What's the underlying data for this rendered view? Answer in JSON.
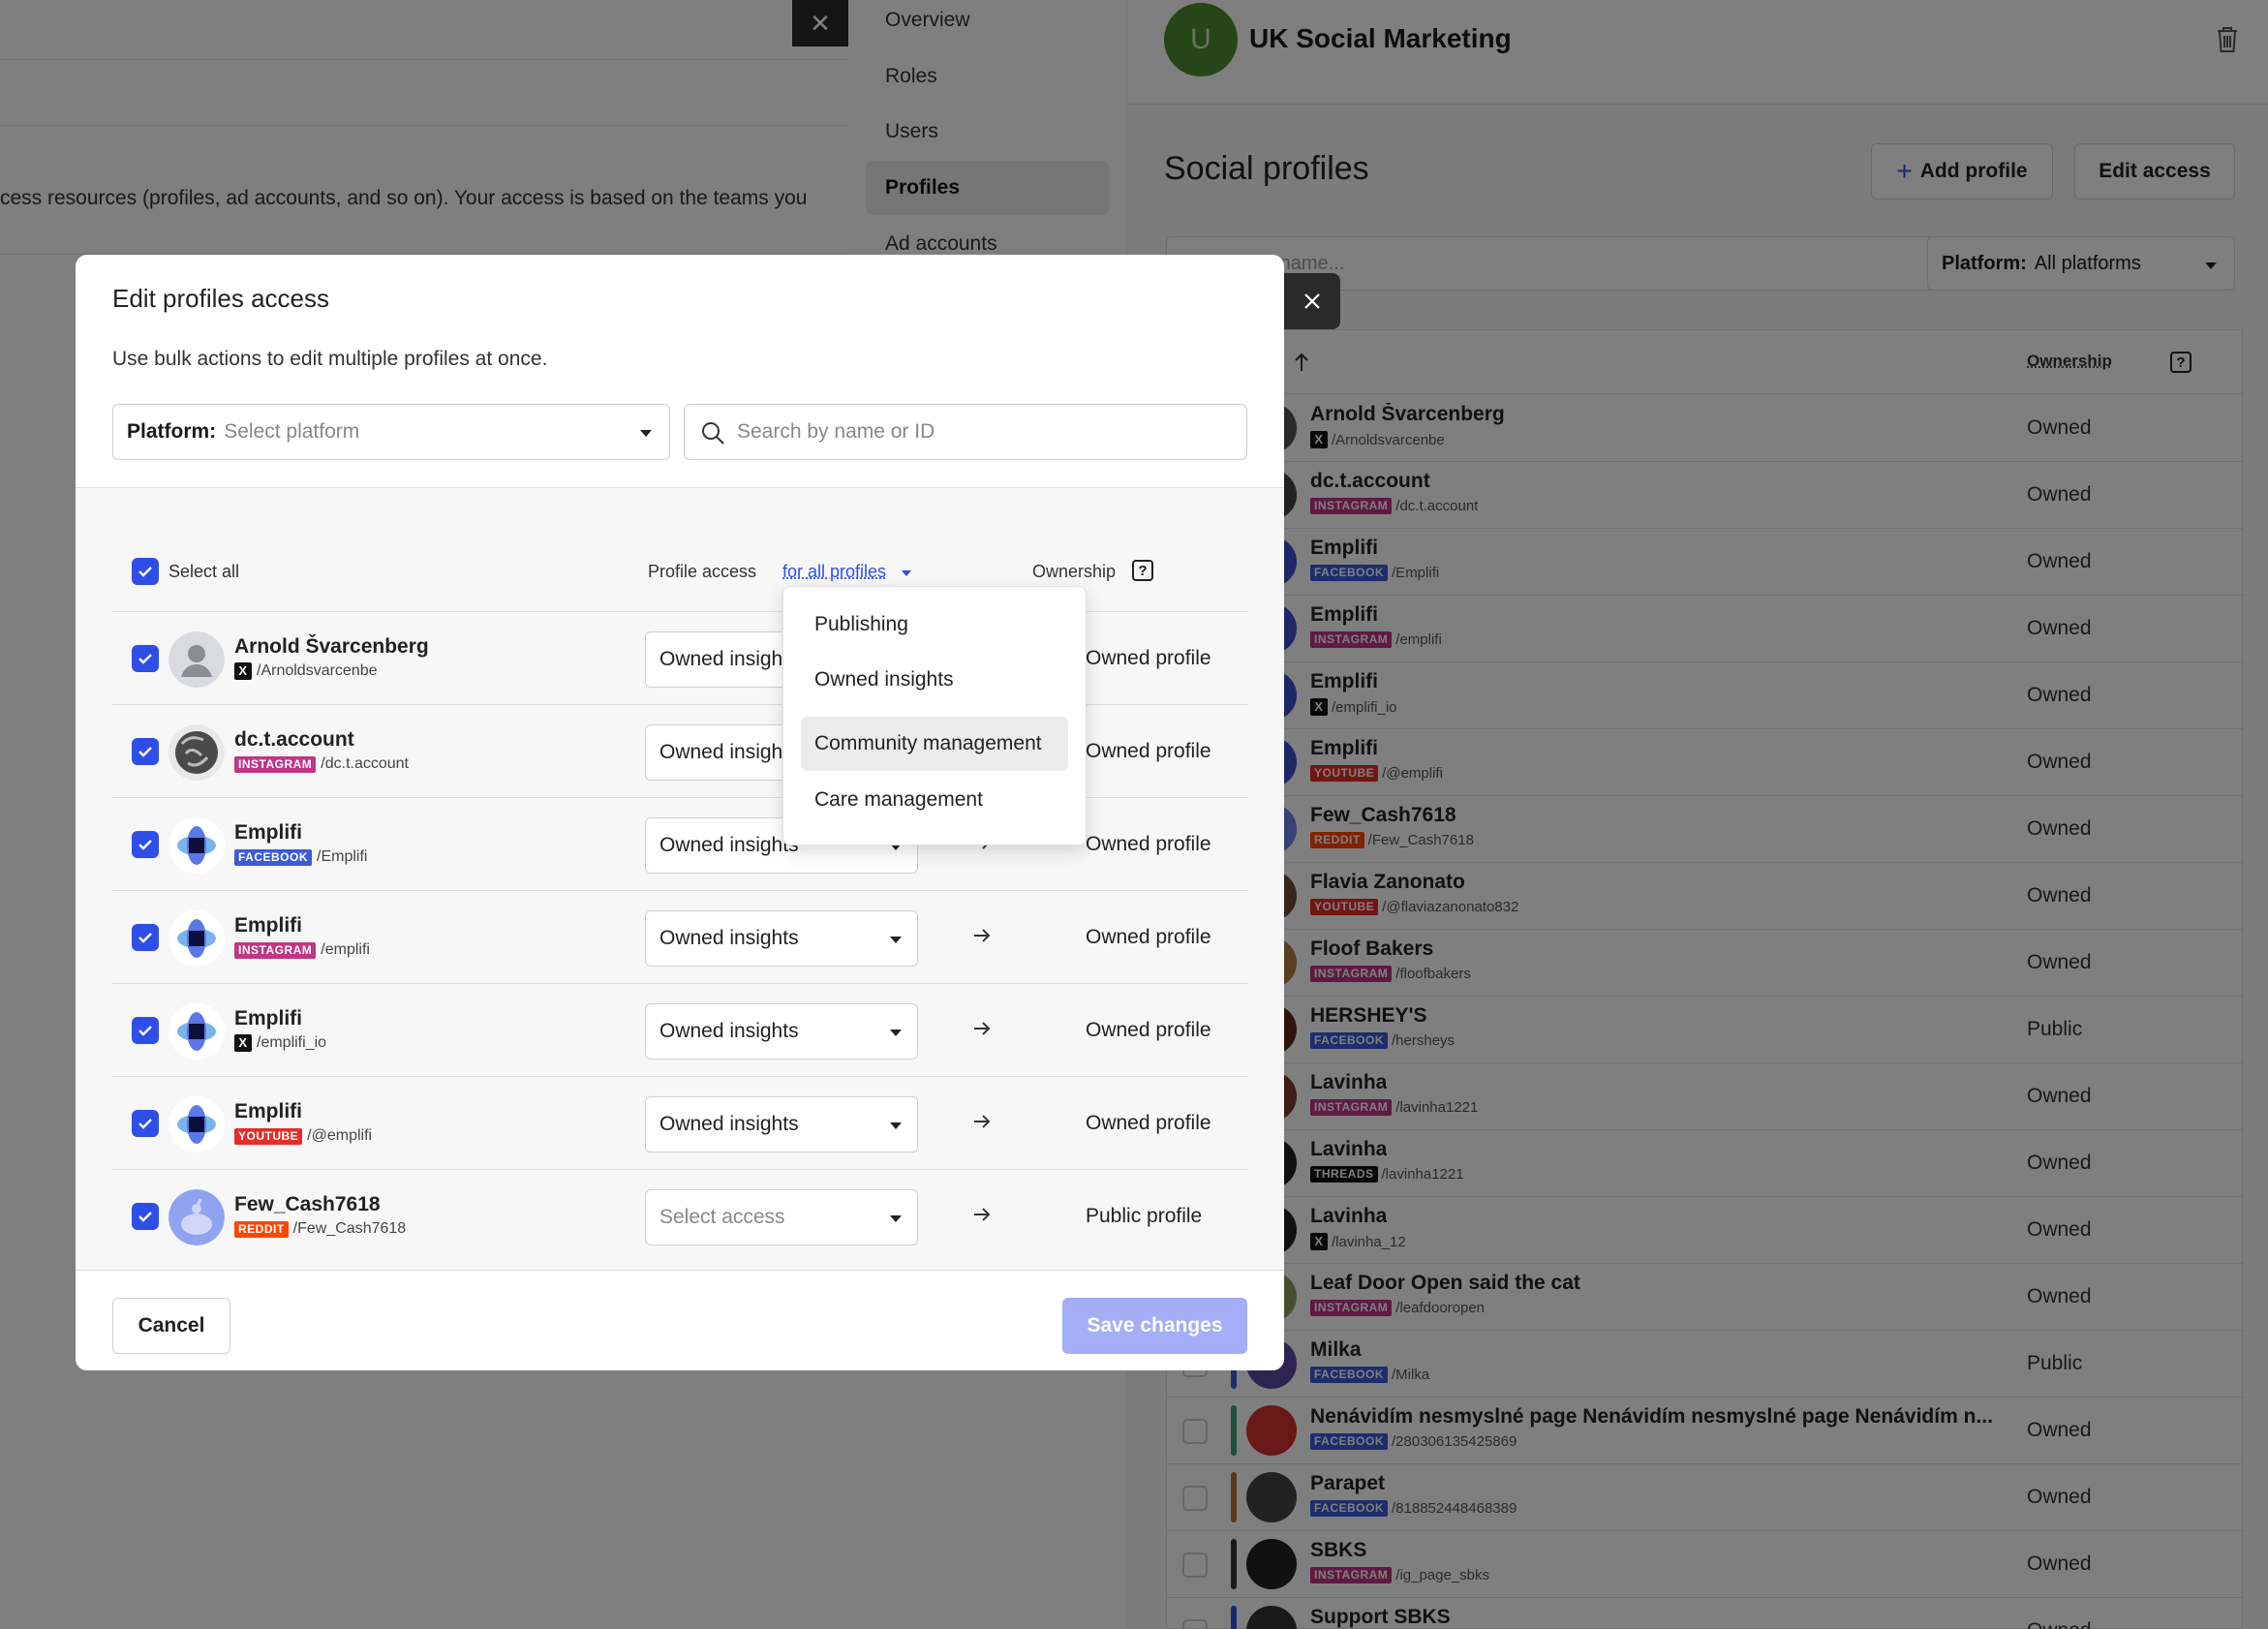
{
  "background": {
    "description_line": "cess resources (profiles, ad accounts, and so on). Your access is based on the teams you",
    "nav": [
      "Overview",
      "Roles",
      "Users",
      "Profiles",
      "Ad accounts"
    ],
    "nav_active": "Profiles",
    "org": {
      "initial": "U",
      "name": "UK Social Marketing"
    },
    "page_title": "Social profiles",
    "add_profile_label": "Add profile",
    "edit_access_label": "Edit access",
    "search_placeholder": "by name...",
    "platform_filter": {
      "label": "Platform:",
      "value": "All platforms"
    },
    "ownership_header": "Ownership",
    "rows": [
      {
        "name": "Arnold Švarcenberg",
        "platform": "X",
        "handle": "/Arnoldsvarcenbe",
        "ownership": "Owned"
      },
      {
        "name": "dc.t.account",
        "platform": "INSTAGRAM",
        "handle": "/dc.t.account",
        "ownership": "Owned"
      },
      {
        "name": "Emplifi",
        "platform": "FACEBOOK",
        "handle": "/Emplifi",
        "ownership": "Owned"
      },
      {
        "name": "Emplifi",
        "platform": "INSTAGRAM",
        "handle": "/emplifi",
        "ownership": "Owned"
      },
      {
        "name": "Emplifi",
        "platform": "X",
        "handle": "/emplifi_io",
        "ownership": "Owned"
      },
      {
        "name": "Emplifi",
        "platform": "YOUTUBE",
        "handle": "/@emplifi",
        "ownership": "Owned"
      },
      {
        "name": "Few_Cash7618",
        "platform": "REDDIT",
        "handle": "/Few_Cash7618",
        "ownership": "Owned"
      },
      {
        "name": "Flavia Zanonato",
        "platform": "YOUTUBE",
        "handle": "/@flaviazanonato832",
        "ownership": "Owned"
      },
      {
        "name": "Floof Bakers",
        "platform": "INSTAGRAM",
        "handle": "/floofbakers",
        "ownership": "Owned"
      },
      {
        "name": "HERSHEY'S",
        "platform": "FACEBOOK",
        "handle": "/hersheys",
        "ownership": "Public"
      },
      {
        "name": "Lavinha",
        "platform": "INSTAGRAM",
        "handle": "/lavinha1221",
        "ownership": "Owned"
      },
      {
        "name": "Lavinha",
        "platform": "THREADS",
        "handle": "/lavinha1221",
        "ownership": "Owned"
      },
      {
        "name": "Lavinha",
        "platform": "X",
        "handle": "/lavinha_12",
        "ownership": "Owned"
      },
      {
        "name": "Leaf Door Open said the cat",
        "platform": "INSTAGRAM",
        "handle": "/leafdooropen",
        "ownership": "Owned"
      },
      {
        "name": "Milka",
        "platform": "FACEBOOK",
        "handle": "/Milka",
        "ownership": "Public"
      },
      {
        "name": "Nenávidím nesmyslné page Nenávidím nesmyslné page Nenávidím n...",
        "platform": "FACEBOOK",
        "handle": "/280306135425869",
        "ownership": "Owned"
      },
      {
        "name": "Parapet",
        "platform": "FACEBOOK",
        "handle": "/818852448468389",
        "ownership": "Owned"
      },
      {
        "name": "SBKS",
        "platform": "INSTAGRAM",
        "handle": "/ig_page_sbks",
        "ownership": "Owned"
      },
      {
        "name": "Support SBKS",
        "platform": "",
        "handle": "",
        "ownership": "Owned"
      }
    ]
  },
  "modal": {
    "title": "Edit profiles access",
    "description": "Use bulk actions to edit multiple profiles at once.",
    "platform": {
      "label": "Platform:",
      "placeholder": "Select platform"
    },
    "search_placeholder": "Search by name or ID",
    "select_all_label": "Select all",
    "profile_access_header": "Profile access",
    "for_all_profiles_link": "for all profiles",
    "ownership_header": "Ownership",
    "help_glyph": "?",
    "rows": [
      {
        "name": "Arnold Švarcenberg",
        "platform": "X",
        "handle": "/Arnoldsvarcenbe",
        "access": "Owned insights",
        "ownership": "Owned profile"
      },
      {
        "name": "dc.t.account",
        "platform": "INSTAGRAM",
        "handle": "/dc.t.account",
        "access": "Owned insights",
        "ownership": "Owned profile"
      },
      {
        "name": "Emplifi",
        "platform": "FACEBOOK",
        "handle": "/Emplifi",
        "access": "Owned insights",
        "ownership": "Owned profile"
      },
      {
        "name": "Emplifi",
        "platform": "INSTAGRAM",
        "handle": "/emplifi",
        "access": "Owned insights",
        "ownership": "Owned profile"
      },
      {
        "name": "Emplifi",
        "platform": "X",
        "handle": "/emplifi_io",
        "access": "Owned insights",
        "ownership": "Owned profile"
      },
      {
        "name": "Emplifi",
        "platform": "YOUTUBE",
        "handle": "/@emplifi",
        "access": "Owned insights",
        "ownership": "Owned profile"
      },
      {
        "name": "Few_Cash7618",
        "platform": "REDDIT",
        "handle": "/Few_Cash7618",
        "access": "Select access",
        "ownership": "Public profile"
      }
    ],
    "cancel_label": "Cancel",
    "save_label": "Save changes",
    "dropdown": {
      "items": [
        "Publishing",
        "Owned insights",
        "Community management",
        "Care management"
      ],
      "hovered": "Community management"
    }
  },
  "colors": {
    "accent": "#2f4ee8",
    "save_disabled": "#a4adf5",
    "instagram": "#c13584",
    "facebook": "#3b5bdb",
    "youtube": "#e52d27",
    "reddit": "#ff4500"
  }
}
